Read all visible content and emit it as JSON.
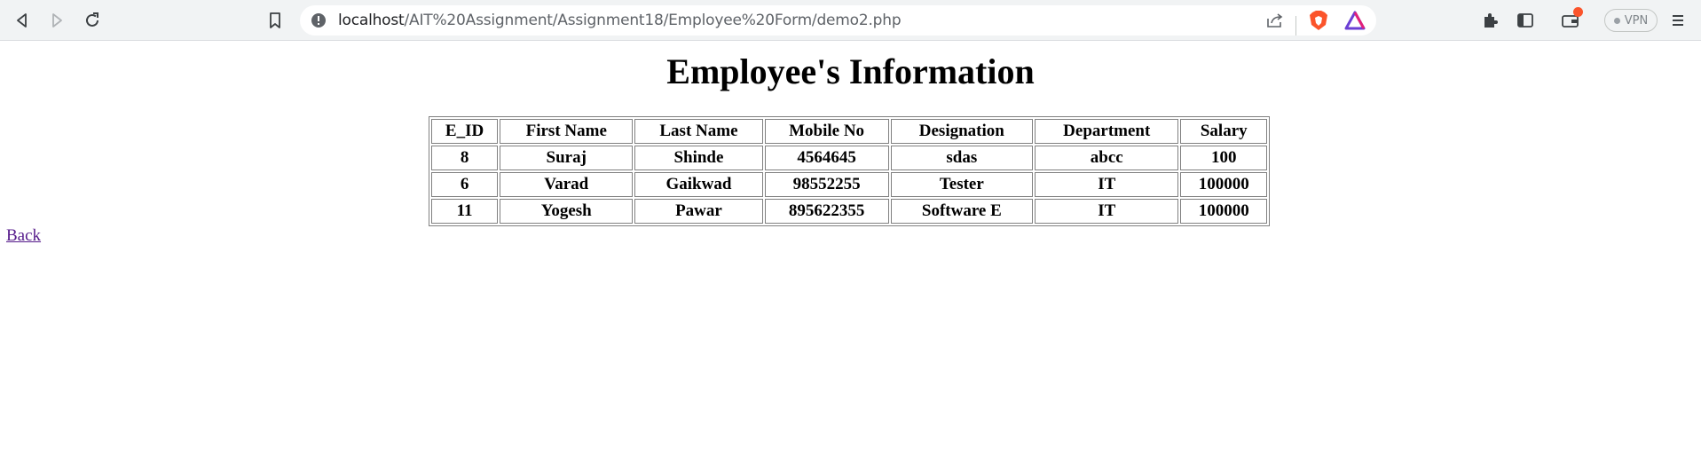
{
  "browser": {
    "url_host": "localhost",
    "url_path": "/AIT%20Assignment/Assignment18/Employee%20Form/demo2.php",
    "vpn_label": "VPN",
    "brand_color": "#fb542b"
  },
  "page": {
    "title": "Employee's Information",
    "back_link": "Back"
  },
  "table": {
    "headers": [
      "E_ID",
      "First Name",
      "Last Name",
      "Mobile No",
      "Designation",
      "Department",
      "Salary"
    ],
    "rows": [
      [
        "8",
        "Suraj",
        "Shinde",
        "4564645",
        "sdas",
        "abcc",
        "100"
      ],
      [
        "6",
        "Varad",
        "Gaikwad",
        "98552255",
        "Tester",
        "IT",
        "100000"
      ],
      [
        "11",
        "Yogesh",
        "Pawar",
        "895622355",
        "Software E",
        "IT",
        "100000"
      ]
    ]
  }
}
